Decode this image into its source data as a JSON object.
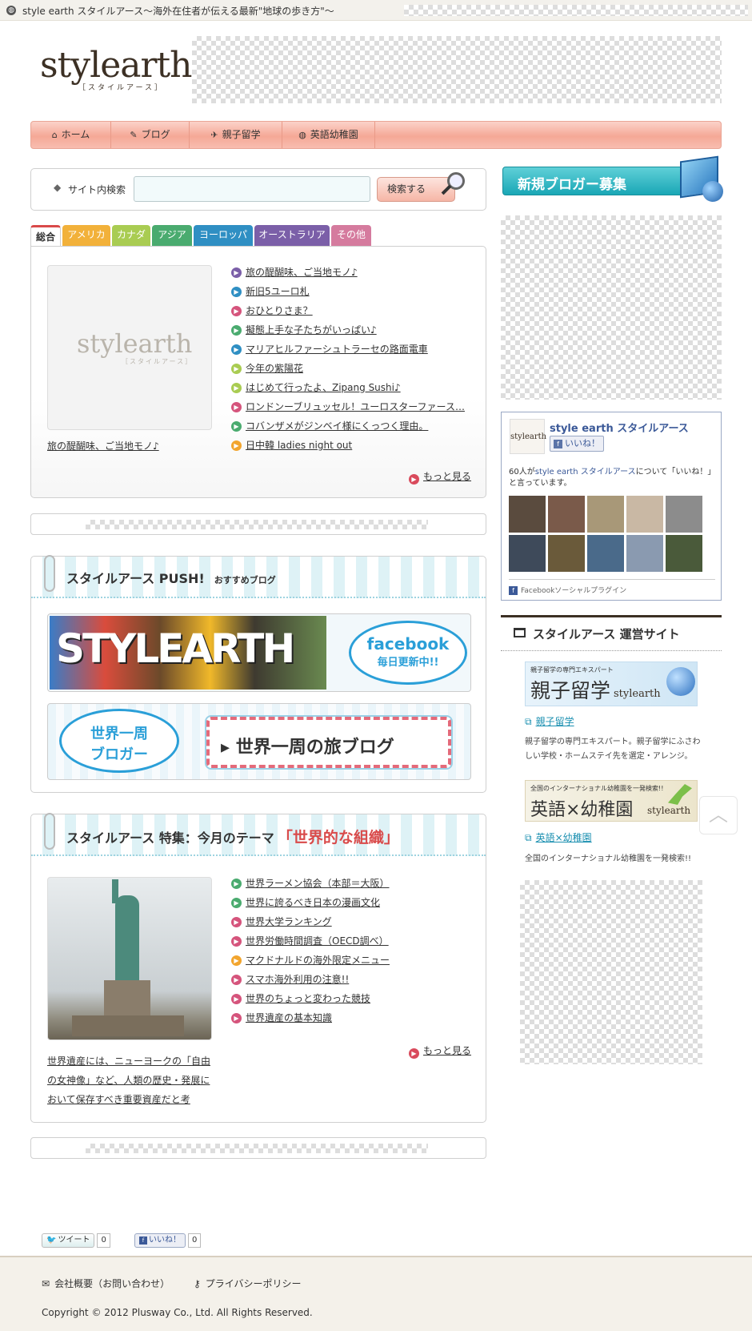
{
  "topbar": {
    "title": "style earth スタイルアース～海外在住者が伝える最新\"地球の歩き方\"～"
  },
  "logo": {
    "main": "stylearth",
    "sub": "［スタイルアース］"
  },
  "nav": {
    "items": [
      {
        "label": "ホーム",
        "icon": "home-icon"
      },
      {
        "label": "ブログ",
        "icon": "pen-icon"
      },
      {
        "label": "親子留学",
        "icon": "airplane-icon"
      },
      {
        "label": "英語幼稚園",
        "icon": "globe-icon"
      }
    ]
  },
  "search": {
    "label": "サイト内検索",
    "placeholder": "",
    "button": "検索する"
  },
  "tabs": [
    {
      "label": "総合",
      "color": "#ffffff"
    },
    {
      "label": "アメリカ",
      "color": "#f2b13a"
    },
    {
      "label": "カナダ",
      "color": "#a9cc52"
    },
    {
      "label": "アジア",
      "color": "#4aab6f"
    },
    {
      "label": "ヨーロッパ",
      "color": "#2f8fc3"
    },
    {
      "label": "オーストラリア",
      "color": "#7b5fa8"
    },
    {
      "label": "その他",
      "color": "#d57b9e"
    }
  ],
  "feature": {
    "thumb_logo": "stylearth",
    "thumb_sub": "［スタイルアース］",
    "caption": "旅の醍醐味、ご当地モノ♪",
    "items": [
      {
        "text": "旅の醍醐味、ご当地モノ♪",
        "color": "#7b5fa8"
      },
      {
        "text": "新旧5ユーロ札",
        "color": "#2f8fc3"
      },
      {
        "text": "おひとりさま？",
        "color": "#d5547c"
      },
      {
        "text": "擬態上手な子たちがいっぱい♪",
        "color": "#4aab6f"
      },
      {
        "text": "マリアヒルファーシュトラーセの路面電車",
        "color": "#2f8fc3"
      },
      {
        "text": "今年の紫陽花",
        "color": "#a9cc52"
      },
      {
        "text": "はじめて行ったよ、Zipang Sushi♪",
        "color": "#a9cc52"
      },
      {
        "text": "ロンドンーブリュッセル！ユーロスターファース…",
        "color": "#d5547c"
      },
      {
        "text": "コバンザメがジンベイ様にくっつく理由。",
        "color": "#4aab6f"
      },
      {
        "text": "日中韓 ladies night out",
        "color": "#f2a52e"
      }
    ],
    "more": "もっと見る"
  },
  "push": {
    "title": "スタイルアース PUSH!",
    "subtitle": "おすすめブログ",
    "banner1": {
      "letters": "STYLEARTH",
      "bubble_line1": "facebook",
      "bubble_line2": "毎日更新中!!"
    },
    "banner2": {
      "bubble_line1": "世界一周",
      "bubble_line2": "ブロガー",
      "title": "世界一周の旅ブログ"
    }
  },
  "special": {
    "title": "スタイルアース 特集：今月のテーマ",
    "theme": "「世界的な組織」",
    "caption": "世界遺産には、ニューヨークの「自由の女神像」など、人類の歴史・発展において保存すべき重要資産だと考",
    "items": [
      {
        "text": "世界ラーメン協会（本部＝大阪）",
        "color": "#4aab6f"
      },
      {
        "text": "世界に誇るべき日本の漫画文化",
        "color": "#4aab6f"
      },
      {
        "text": "世界大学ランキング",
        "color": "#d5547c"
      },
      {
        "text": "世界労働時間調査（OECD調べ）",
        "color": "#d5547c"
      },
      {
        "text": "マクドナルドの海外限定メニュー",
        "color": "#f2a52e"
      },
      {
        "text": "スマホ海外利用の注意!!",
        "color": "#d5547c"
      },
      {
        "text": "世界のちょっと変わった競技",
        "color": "#d5547c"
      },
      {
        "text": "世界遺産の基本知識",
        "color": "#d5547c"
      }
    ],
    "more": "もっと見る"
  },
  "sidebar": {
    "recruit": "新規ブロガー募集",
    "fb": {
      "name": "style earth スタイルアース",
      "like": "いいね！",
      "count_text_pre": "60人が",
      "count_link": "style earth スタイルアース",
      "count_text_post": "について「いいね！」と言っています。",
      "plugin": "Facebookソーシャルプラグイン",
      "avatar_colors": [
        "#5a4b3e",
        "#7a5a4a",
        "#a89878",
        "#c9b8a4",
        "#8c8c8c",
        "#3e4a5a",
        "#6a5a3a",
        "#4a6a8a",
        "#8a9ab0",
        "#4a5a3a"
      ]
    },
    "sites_title": "スタイルアース 運営サイト",
    "site1": {
      "banner_small": "親子留学の専門エキスパート",
      "banner_big": "親子留学",
      "banner_logo": "stylearth",
      "link": "親子留学",
      "desc": "親子留学の専門エキスパート。親子留学にふさわしい学校・ホームステイ先を選定・アレンジ。"
    },
    "site2": {
      "banner_small": "全国のインターナショナル幼稚園を一発検索!!",
      "banner_big": "英語×幼稚園",
      "banner_logo": "stylearth",
      "link": "英語×幼稚園",
      "desc": "全国のインターナショナル幼稚園を一発検索!!"
    }
  },
  "social": {
    "tweet": "ツイート",
    "tweet_count": "0",
    "like": "いいね！",
    "like_count": "0"
  },
  "footer": {
    "links": [
      {
        "label": "会社概要（お問い合わせ）",
        "icon": "mail-icon"
      },
      {
        "label": "プライバシーポリシー",
        "icon": "key-icon"
      }
    ],
    "copyright": "Copyright © 2012 Plusway Co., Ltd. All Rights Reserved."
  }
}
